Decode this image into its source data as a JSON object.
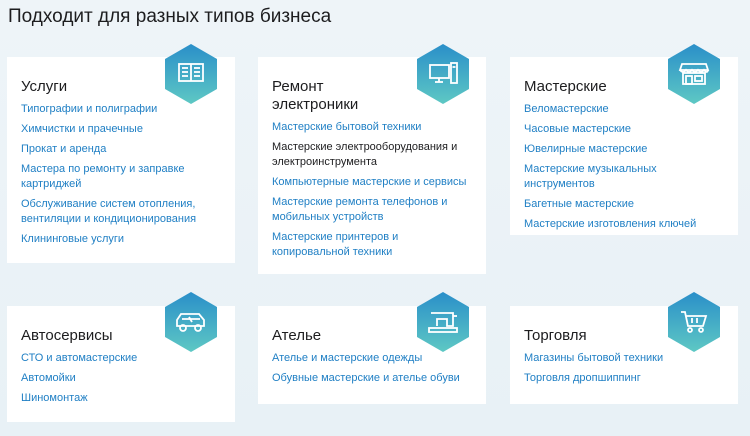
{
  "page": {
    "title": "Подходит для разных типов бизнеса"
  },
  "colors": {
    "link": "#1f7fc4",
    "hex_top": "#2a8fc9",
    "hex_bottom": "#5ec8c4"
  },
  "cards": [
    {
      "title": "Услуги",
      "icon": "book-icon",
      "items": [
        {
          "label": "Типографии и полиграфии",
          "link": true
        },
        {
          "label": "Химчистки и прачечные",
          "link": true
        },
        {
          "label": "Прокат и аренда",
          "link": true
        },
        {
          "label": "Мастера по ремонту и заправке картриджей",
          "link": true
        },
        {
          "label": "Обслуживание систем отопления, вентиляции и кондиционирования",
          "link": true
        },
        {
          "label": "Клининговые услуги",
          "link": true
        }
      ]
    },
    {
      "title": "Ремонт электроники",
      "icon": "computer-icon",
      "items": [
        {
          "label": "Мастерские бытовой техники",
          "link": true
        },
        {
          "label": "Мастерские электрооборудования и электроинструмента",
          "link": false
        },
        {
          "label": "Компьютерные мастерские и сервисы",
          "link": true
        },
        {
          "label": "Мастерские ремонта телефонов и мобильных устройств",
          "link": true
        },
        {
          "label": "Мастерские принтеров и копировальной техники",
          "link": true
        }
      ]
    },
    {
      "title": "Мастерские",
      "icon": "workshop-icon",
      "items": [
        {
          "label": "Веломастерские",
          "link": true
        },
        {
          "label": "Часовые мастерские",
          "link": true
        },
        {
          "label": "Ювелирные мастерские",
          "link": true
        },
        {
          "label": "Мастерские музыкальных инструментов",
          "link": true
        },
        {
          "label": "Багетные мастерские",
          "link": true
        },
        {
          "label": "Мастерские изготовления ключей",
          "link": true
        }
      ]
    },
    {
      "title": "Автосервисы",
      "icon": "car-icon",
      "items": [
        {
          "label": "СТО и автомастерские",
          "link": true
        },
        {
          "label": "Автомойки",
          "link": true
        },
        {
          "label": "Шиномонтаж",
          "link": true
        }
      ]
    },
    {
      "title": "Ателье",
      "icon": "sewing-machine-icon",
      "items": [
        {
          "label": "Ателье и мастерские одежды",
          "link": true
        },
        {
          "label": "Обувные мастерские и ателье обуви",
          "link": true
        }
      ]
    },
    {
      "title": "Торговля",
      "icon": "cart-icon",
      "items": [
        {
          "label": "Магазины бытовой техники",
          "link": true
        },
        {
          "label": "Торговля дропшиппинг",
          "link": true
        }
      ]
    }
  ]
}
